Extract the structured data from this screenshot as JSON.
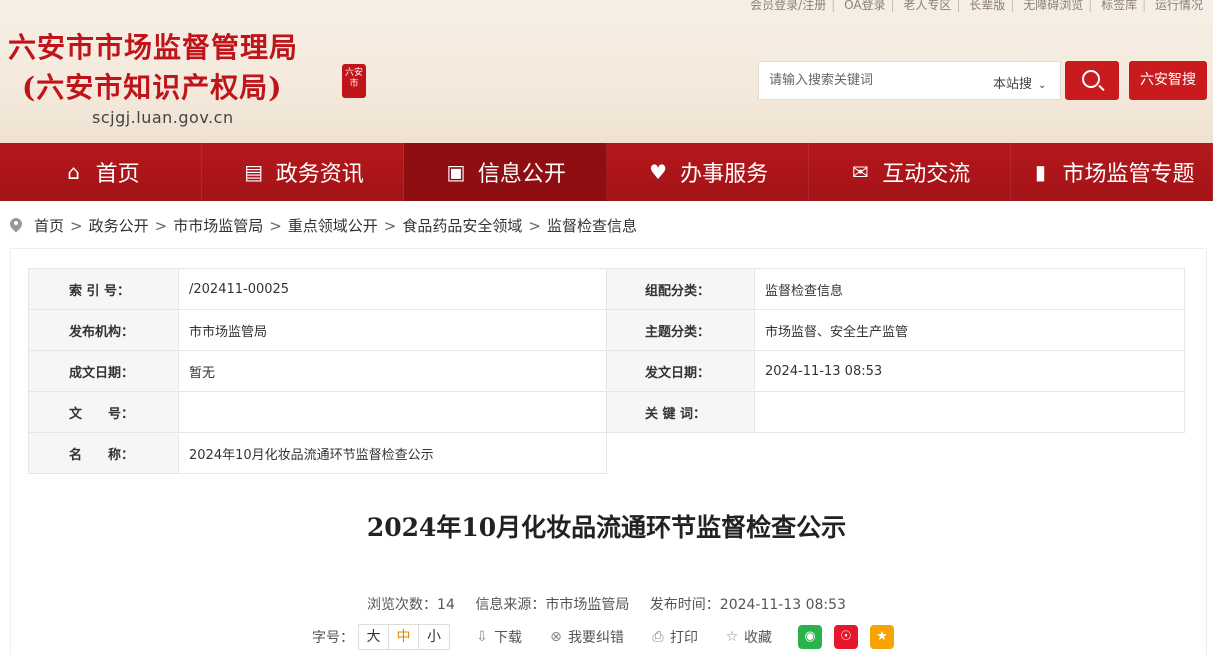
{
  "header": {
    "toplinks": [
      "会员登录/注册",
      "OA登录",
      "老人专区",
      "长辈版",
      "无障碍浏览",
      "标签库",
      "运行情况"
    ],
    "title_line1": "六安市市场监督管理局",
    "title_line2": "(六安市知识产权局)",
    "seal_text": "六安市",
    "domain": "scjgj.luan.gov.cn",
    "search_placeholder": "请输入搜索关键词",
    "search_scope": "本站搜",
    "smart_search_label": "六安智搜"
  },
  "nav": [
    {
      "label": "首页",
      "icon": "home-icon"
    },
    {
      "label": "政务资讯",
      "icon": "document-icon"
    },
    {
      "label": "信息公开",
      "icon": "book-icon"
    },
    {
      "label": "办事服务",
      "icon": "heart-icon"
    },
    {
      "label": "互动交流",
      "icon": "chat-icon"
    },
    {
      "label": "市场监管专题",
      "icon": "bookmark-icon"
    }
  ],
  "breadcrumb": [
    "首页",
    "政务公开",
    "市市场监管局",
    "重点领域公开",
    "食品药品安全领域",
    "监督检查信息"
  ],
  "meta": {
    "index_label": "索 引 号：",
    "index_value": "/202411-00025",
    "category_label": "组配分类：",
    "category_value": "监督检查信息",
    "publisher_label": "发布机构：",
    "publisher_value": "市市场监管局",
    "topic_label": "主题分类：",
    "topic_value": "市场监督、安全生产监管",
    "created_label": "成文日期：",
    "created_value": "暂无",
    "issued_label": "发文日期：",
    "issued_value": "2024-11-13 08:53",
    "docno_label": "文　　号：",
    "docno_value": "",
    "keywords_label": "关 键 词：",
    "keywords_value": "",
    "name_label": "名　　称：",
    "name_value": "2024年10月化妆品流通环节监督检查公示"
  },
  "article": {
    "title": "2024年10月化妆品流通环节监督检查公示",
    "views": "浏览次数：14",
    "source": "信息来源：市市场监管局",
    "published": "发布时间：2024-11-13 08:53"
  },
  "tools": {
    "font_label": "字号：",
    "font_large": "大",
    "font_medium": "中",
    "font_small": "小",
    "download": "下载",
    "correct": "我要纠错",
    "print": "打印",
    "favorite": "收藏"
  },
  "colors": {
    "brand_red": "#c0141b",
    "nav_red": "#b5181c"
  }
}
